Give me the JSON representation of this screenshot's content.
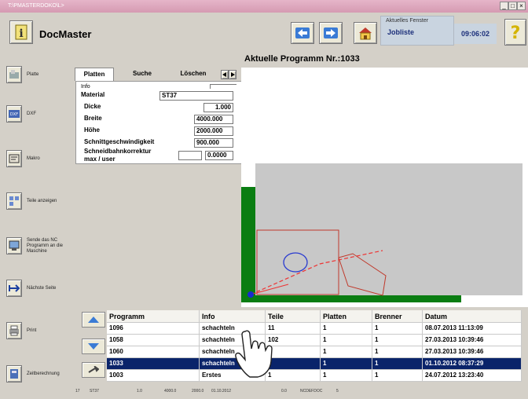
{
  "window": {
    "title": "T:\\PMASTERDOKO\\L>",
    "controls": [
      "_",
      "□",
      "×"
    ]
  },
  "header": {
    "app_title": "DocMaster",
    "status_label": "Aktuelles Fenster",
    "status_value": "Jobliste",
    "clock": "09:06:02"
  },
  "program_title": "Aktuelle Programm Nr.:1033",
  "sidebar": {
    "items": [
      {
        "label": "Platte",
        "icon": "plate-icon"
      },
      {
        "label": "DXF",
        "icon": "dxf-icon"
      },
      {
        "label": "Makro",
        "icon": "macro-icon"
      },
      {
        "label": "Teile anzeigen",
        "icon": "parts-icon"
      },
      {
        "label": "Sende das NC Programm an die Maschine",
        "icon": "send-nc-icon"
      },
      {
        "label": "Nächste Seite",
        "icon": "next-page-icon"
      },
      {
        "label": "Print",
        "icon": "printer-icon"
      },
      {
        "label": "Zeitberechnung",
        "icon": "calculator-icon"
      }
    ]
  },
  "tabs": [
    {
      "label": "Platten"
    },
    {
      "label": "Suche"
    },
    {
      "label": "Löschen"
    }
  ],
  "info": {
    "group_label": "Info",
    "fields": [
      {
        "label": "Material",
        "value": "ST37"
      },
      {
        "label": "Dicke",
        "value": "1.000"
      },
      {
        "label": "Breite",
        "value": "4000.000"
      },
      {
        "label": "Höhe",
        "value": "2000.000"
      },
      {
        "label": "Schnittgeschwindigkeit",
        "value": "900.000"
      }
    ],
    "kerf_label_1": "Schneidbahnkorrektur",
    "kerf_label_2": "max / user",
    "kerf_max": "",
    "kerf_user": "0.0000"
  },
  "table": {
    "columns": [
      "Programm",
      "Info",
      "Teile",
      "Platten",
      "Brenner",
      "Datum"
    ],
    "rows": [
      [
        "1096",
        "schachteln",
        "11",
        "1",
        "1",
        "08.07.2013 11:13:09"
      ],
      [
        "1058",
        "schachteln",
        "102",
        "1",
        "1",
        "27.03.2013 10:39:46"
      ],
      [
        "1060",
        "schachteln",
        "",
        "1",
        "1",
        "27.03.2013 10:39:46"
      ],
      [
        "1033",
        "schachteln",
        "",
        "1",
        "1",
        "01.10.2012 08:37:29"
      ],
      [
        "1003",
        "Erstes",
        "1",
        "1",
        "1",
        "24.07.2012 13:23:40"
      ]
    ],
    "selected_row": 3
  },
  "statusbar": [
    "17",
    "ST37",
    "1.0",
    "4000.0",
    "2000.0",
    "01.10.2012",
    "0.0",
    "NCDEFDOC",
    "5"
  ],
  "colors": {
    "selection": "#0a246a",
    "plate": "#c8c8c8",
    "frame_green": "#0a7d12"
  }
}
